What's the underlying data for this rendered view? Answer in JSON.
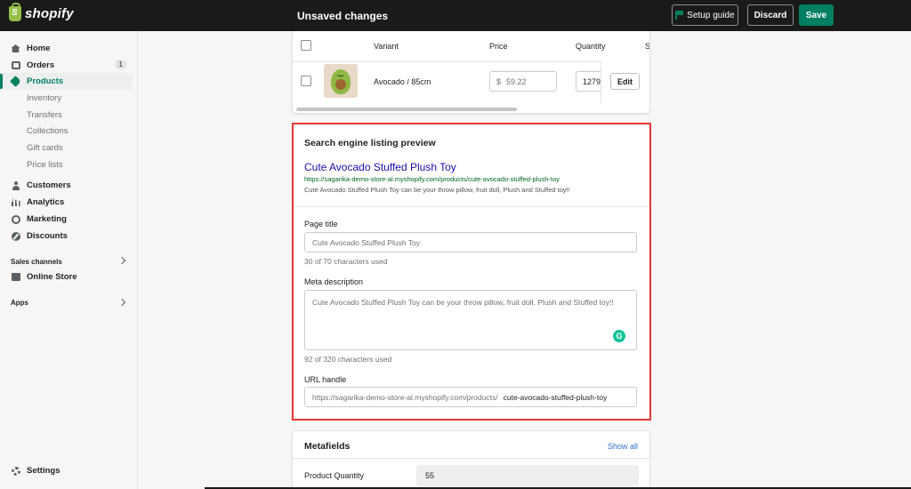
{
  "app": {
    "brand": "shopify"
  },
  "topbar": {
    "title": "Unsaved changes",
    "setup_guide": "Setup guide",
    "discard": "Discard",
    "save": "Save"
  },
  "sidebar": {
    "items": [
      {
        "label": "Home",
        "icon": "home-icon"
      },
      {
        "label": "Orders",
        "icon": "orders-icon",
        "badge": "1"
      },
      {
        "label": "Products",
        "icon": "tag-icon",
        "active": true
      },
      {
        "label": "Inventory"
      },
      {
        "label": "Transfers"
      },
      {
        "label": "Collections"
      },
      {
        "label": "Gift cards"
      },
      {
        "label": "Price lists"
      },
      {
        "label": "Customers",
        "icon": "customers-icon"
      },
      {
        "label": "Analytics",
        "icon": "analytics-icon"
      },
      {
        "label": "Marketing",
        "icon": "marketing-icon"
      },
      {
        "label": "Discounts",
        "icon": "discounts-icon"
      }
    ],
    "sales_channels": "Sales channels",
    "online_store": "Online Store",
    "apps": "Apps",
    "settings": "Settings"
  },
  "variants": {
    "headers": {
      "variant": "Variant",
      "price": "Price",
      "quantity": "Quantity",
      "extra": "S"
    },
    "row": {
      "name": "Avocado / 85cm",
      "currency": "$",
      "price": "59.22",
      "quantity": "1279",
      "edit": "Edit"
    }
  },
  "seo": {
    "title": "Search engine listing preview",
    "preview_title": "Cute Avocado Stuffed Plush Toy",
    "preview_url": "https://sagarika-demo-store-al.myshopify.com/products/cute-avocado-stuffed-plush-toy",
    "preview_desc": "Cute Avocado Stuffed Plush Toy can be your throw pillow, fruit doll, Plush and Stuffed toy!!",
    "page_title_label": "Page title",
    "page_title_value": "Cute Avocado Stuffed Plush Toy",
    "page_title_help": "30 of 70 characters used",
    "meta_desc_label": "Meta description",
    "meta_desc_value": "Cute Avocado Stuffed Plush Toy can be your throw pillow, fruit doll, Plush and Stuffed toy!!",
    "meta_desc_help": "92 of 320 characters used",
    "url_label": "URL handle",
    "url_prefix": "https://sagarika-demo-store-al.myshopify.com/products/",
    "url_handle": "cute-avocado-stuffed-plush-toy"
  },
  "metafields": {
    "title": "Metafields",
    "show_all": "Show all",
    "row_label": "Product Quantity",
    "row_value": "55"
  },
  "colors": {
    "accent": "#008060",
    "highlight": "#e53935",
    "link": "#1a0dab",
    "url": "#006621"
  }
}
